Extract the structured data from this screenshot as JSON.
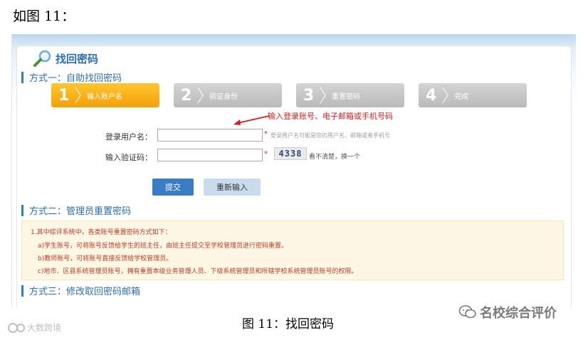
{
  "doc": {
    "heading": "如图 11：",
    "caption": "图 11：找回密码"
  },
  "page": {
    "title": "找回密码",
    "method1": "方式一：自助找回密码",
    "method2": "方式二：管理员重置密码",
    "method3": "方式三：修改取回密码邮箱"
  },
  "steps": [
    {
      "num": "1",
      "label": "输入账户名",
      "active": true
    },
    {
      "num": "2",
      "label": "验证身份",
      "active": false
    },
    {
      "num": "3",
      "label": "重置密码",
      "active": false
    },
    {
      "num": "4",
      "label": "完成",
      "active": false
    }
  ],
  "annotation": "输入登录账号、电子邮箱或手机号码",
  "form": {
    "username_label": "登录用户名：",
    "username_value": "",
    "username_hint": "登录用户名可能是您的用户名、邮箱或者手机号",
    "captcha_label": "输入验证码：",
    "captcha_value": "",
    "captcha_code": "4338",
    "captcha_refresh": "看不清楚，换一个",
    "required_mark": "*"
  },
  "buttons": {
    "submit": "提交",
    "reset": "重新输入"
  },
  "notice": {
    "lines": [
      "1.其中综评系统中，各类账号重置密码方式如下：",
      "a)学生账号，可将账号反馈给学生的班主任，由班主任提交至学校管理员进行密码重置。",
      "b)教师账号，可将账号直接反馈给学校管理员。",
      "c)地市、区县系统管理员账号，拥有重置本级业务管理人员、下级系统管理员和所辖学校系统管理员账号的权限。"
    ]
  },
  "watermarks": {
    "left": "大数跨境",
    "right": "名校综合评价"
  },
  "colors": {
    "accent": "#2f6eb5",
    "active_step": "#f5a623",
    "inactive_step": "#c4c4c4",
    "annotation": "#d81e1e",
    "notice_bg": "#fdf7e3"
  },
  "icons": {
    "title": "magnifier-icon",
    "annotation": "red-arrow-icon",
    "left_watermark": "logo-icon",
    "right_watermark": "wechat-icon"
  }
}
